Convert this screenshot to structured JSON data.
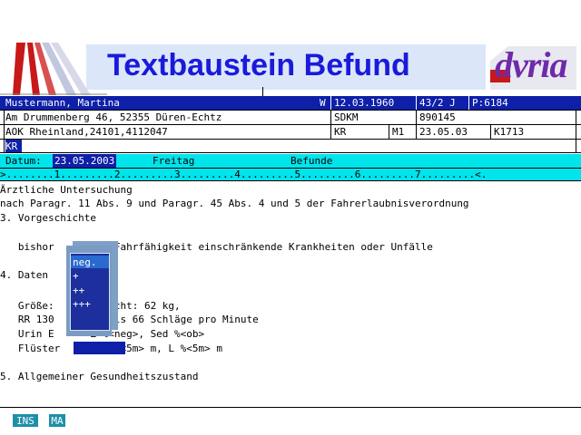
{
  "header": {
    "title": "Textbaustein Befund",
    "logo": "dvria"
  },
  "patient": {
    "name": "Mustermann, Martina",
    "sex": "W",
    "birthdate": "12.03.1960",
    "age": "43/2 J",
    "pid": "P:6184",
    "address": "Am Drummenberg 46, 52355 Düren-Echtz",
    "kasse": "SDKM",
    "kasse_no": "890145",
    "insurer": "AOK Rheinland,24101,4112047",
    "status_kr": "KR",
    "m1": "M1",
    "date2": "23.05.03",
    "k_code": "K1713",
    "kr_field": "KR"
  },
  "datum_bar": {
    "label": "Datum:",
    "value": "23.05.2003",
    "day": "Freitag",
    "section": "Befunde"
  },
  "ruler": ">........1.........2.........3.........4.........5.........6.........7.........<.",
  "document": {
    "lines": [
      "Ärztliche Untersuchung",
      "nach Paragr. 11 Abs. 9 und Paragr. 45 Abs. 4 und 5 der Fahrerlaubnisverordnung",
      "3. Vorgeschichte",
      "",
      "   bishor      die Fahrfähigkeit einschränkende Krankheiten oder Unfälle",
      "",
      "4. Daten",
      "",
      "   Größe:      Gewicht: 62 kg,",
      "   RR 130      , Puls 66 Schläge pro Minute",
      "   Urin E      Z %<neg>, Sed %<ob>",
      "   Flüster       R %<5m> m, L %<5m> m",
      "",
      "5. Allgemeiner Gesundheitszustand"
    ]
  },
  "popup": {
    "options": [
      "neg.",
      "+",
      "++",
      "+++"
    ],
    "selected_index": 0
  },
  "status": {
    "ins": "INS",
    "ma": "MA"
  },
  "colors": {
    "banner_title": "#1a1adc",
    "header_blue": "#0e1fa8",
    "cyan_bar": "#00e4ec",
    "popup_bg": "#1d2f9c",
    "status_teal": "#1e8fa8"
  }
}
